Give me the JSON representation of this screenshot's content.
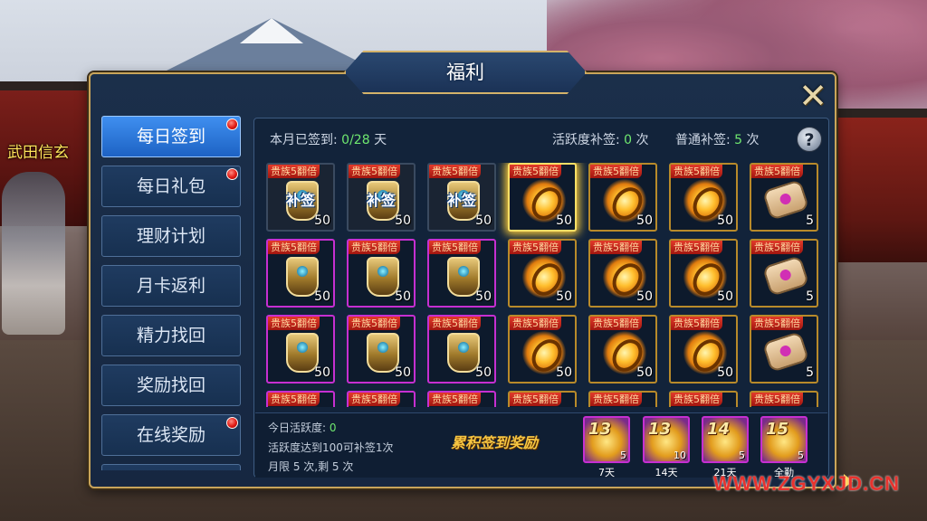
{
  "background": {
    "npc_name": "武田信玄",
    "watermark": "WWW.ZGYXJD.CN"
  },
  "window": {
    "title": "福利",
    "close_glyph": "✕"
  },
  "menu": {
    "items": [
      {
        "label": "每日签到",
        "active": true,
        "dot": true
      },
      {
        "label": "每日礼包",
        "active": false,
        "dot": true
      },
      {
        "label": "理财计划",
        "active": false,
        "dot": false
      },
      {
        "label": "月卡返利",
        "active": false,
        "dot": false
      },
      {
        "label": "精力找回",
        "active": false,
        "dot": false
      },
      {
        "label": "奖励找回",
        "active": false,
        "dot": false
      },
      {
        "label": "在线奖励",
        "active": false,
        "dot": true
      }
    ]
  },
  "stats": {
    "signed_label": "本月已签到:",
    "signed_value": "0/28",
    "signed_unit": "天",
    "active_resign_label": "活跃度补签:",
    "active_resign_value": "0",
    "active_resign_unit": "次",
    "normal_resign_label": "普通补签:",
    "normal_resign_value": "5",
    "normal_resign_unit": "次",
    "help_glyph": "?"
  },
  "grid": {
    "badge_text": "贵族5翻倍",
    "resign_text": "补签",
    "rows": [
      [
        {
          "icon": "crest",
          "qty": "50",
          "state": "signed"
        },
        {
          "icon": "crest",
          "qty": "50",
          "state": "signed"
        },
        {
          "icon": "crest",
          "qty": "50",
          "state": "signed"
        },
        {
          "icon": "ring",
          "qty": "50",
          "state": "today"
        },
        {
          "icon": "ring",
          "qty": "50",
          "state": "gold"
        },
        {
          "icon": "ring",
          "qty": "50",
          "state": "gold"
        },
        {
          "icon": "scroll",
          "qty": "5",
          "state": "gold"
        }
      ],
      [
        {
          "icon": "crest",
          "qty": "50",
          "state": "purple"
        },
        {
          "icon": "crest",
          "qty": "50",
          "state": "purple"
        },
        {
          "icon": "crest",
          "qty": "50",
          "state": "purple"
        },
        {
          "icon": "ring",
          "qty": "50",
          "state": "gold"
        },
        {
          "icon": "ring",
          "qty": "50",
          "state": "gold"
        },
        {
          "icon": "ring",
          "qty": "50",
          "state": "gold"
        },
        {
          "icon": "scroll",
          "qty": "5",
          "state": "gold"
        }
      ],
      [
        {
          "icon": "crest",
          "qty": "50",
          "state": "purple"
        },
        {
          "icon": "crest",
          "qty": "50",
          "state": "purple"
        },
        {
          "icon": "crest",
          "qty": "50",
          "state": "purple"
        },
        {
          "icon": "ring",
          "qty": "50",
          "state": "gold"
        },
        {
          "icon": "ring",
          "qty": "50",
          "state": "gold"
        },
        {
          "icon": "ring",
          "qty": "50",
          "state": "gold"
        },
        {
          "icon": "scroll",
          "qty": "5",
          "state": "gold"
        }
      ],
      [
        {
          "icon": "crest",
          "qty": "",
          "state": "purple"
        },
        {
          "icon": "crest",
          "qty": "",
          "state": "purple"
        },
        {
          "icon": "crest",
          "qty": "",
          "state": "purple"
        },
        {
          "icon": "ring",
          "qty": "",
          "state": "gold"
        },
        {
          "icon": "ring",
          "qty": "",
          "state": "gold"
        },
        {
          "icon": "ring",
          "qty": "",
          "state": "gold"
        },
        {
          "icon": "scroll",
          "qty": "",
          "state": "gold"
        }
      ]
    ]
  },
  "bottom": {
    "today_active_label": "今日活跃度:",
    "today_active_value": "0",
    "rule_line": "活跃度达到100可补签1次",
    "limit_line": "月限 5 次,剩 5 次",
    "reward_title": "累积签到奖励",
    "chests": [
      {
        "num": "13",
        "qty": "5",
        "label": "7天"
      },
      {
        "num": "13",
        "qty": "10",
        "label": "14天"
      },
      {
        "num": "14",
        "qty": "5",
        "label": "21天"
      },
      {
        "num": "15",
        "qty": "5",
        "label": "全勤"
      }
    ]
  }
}
